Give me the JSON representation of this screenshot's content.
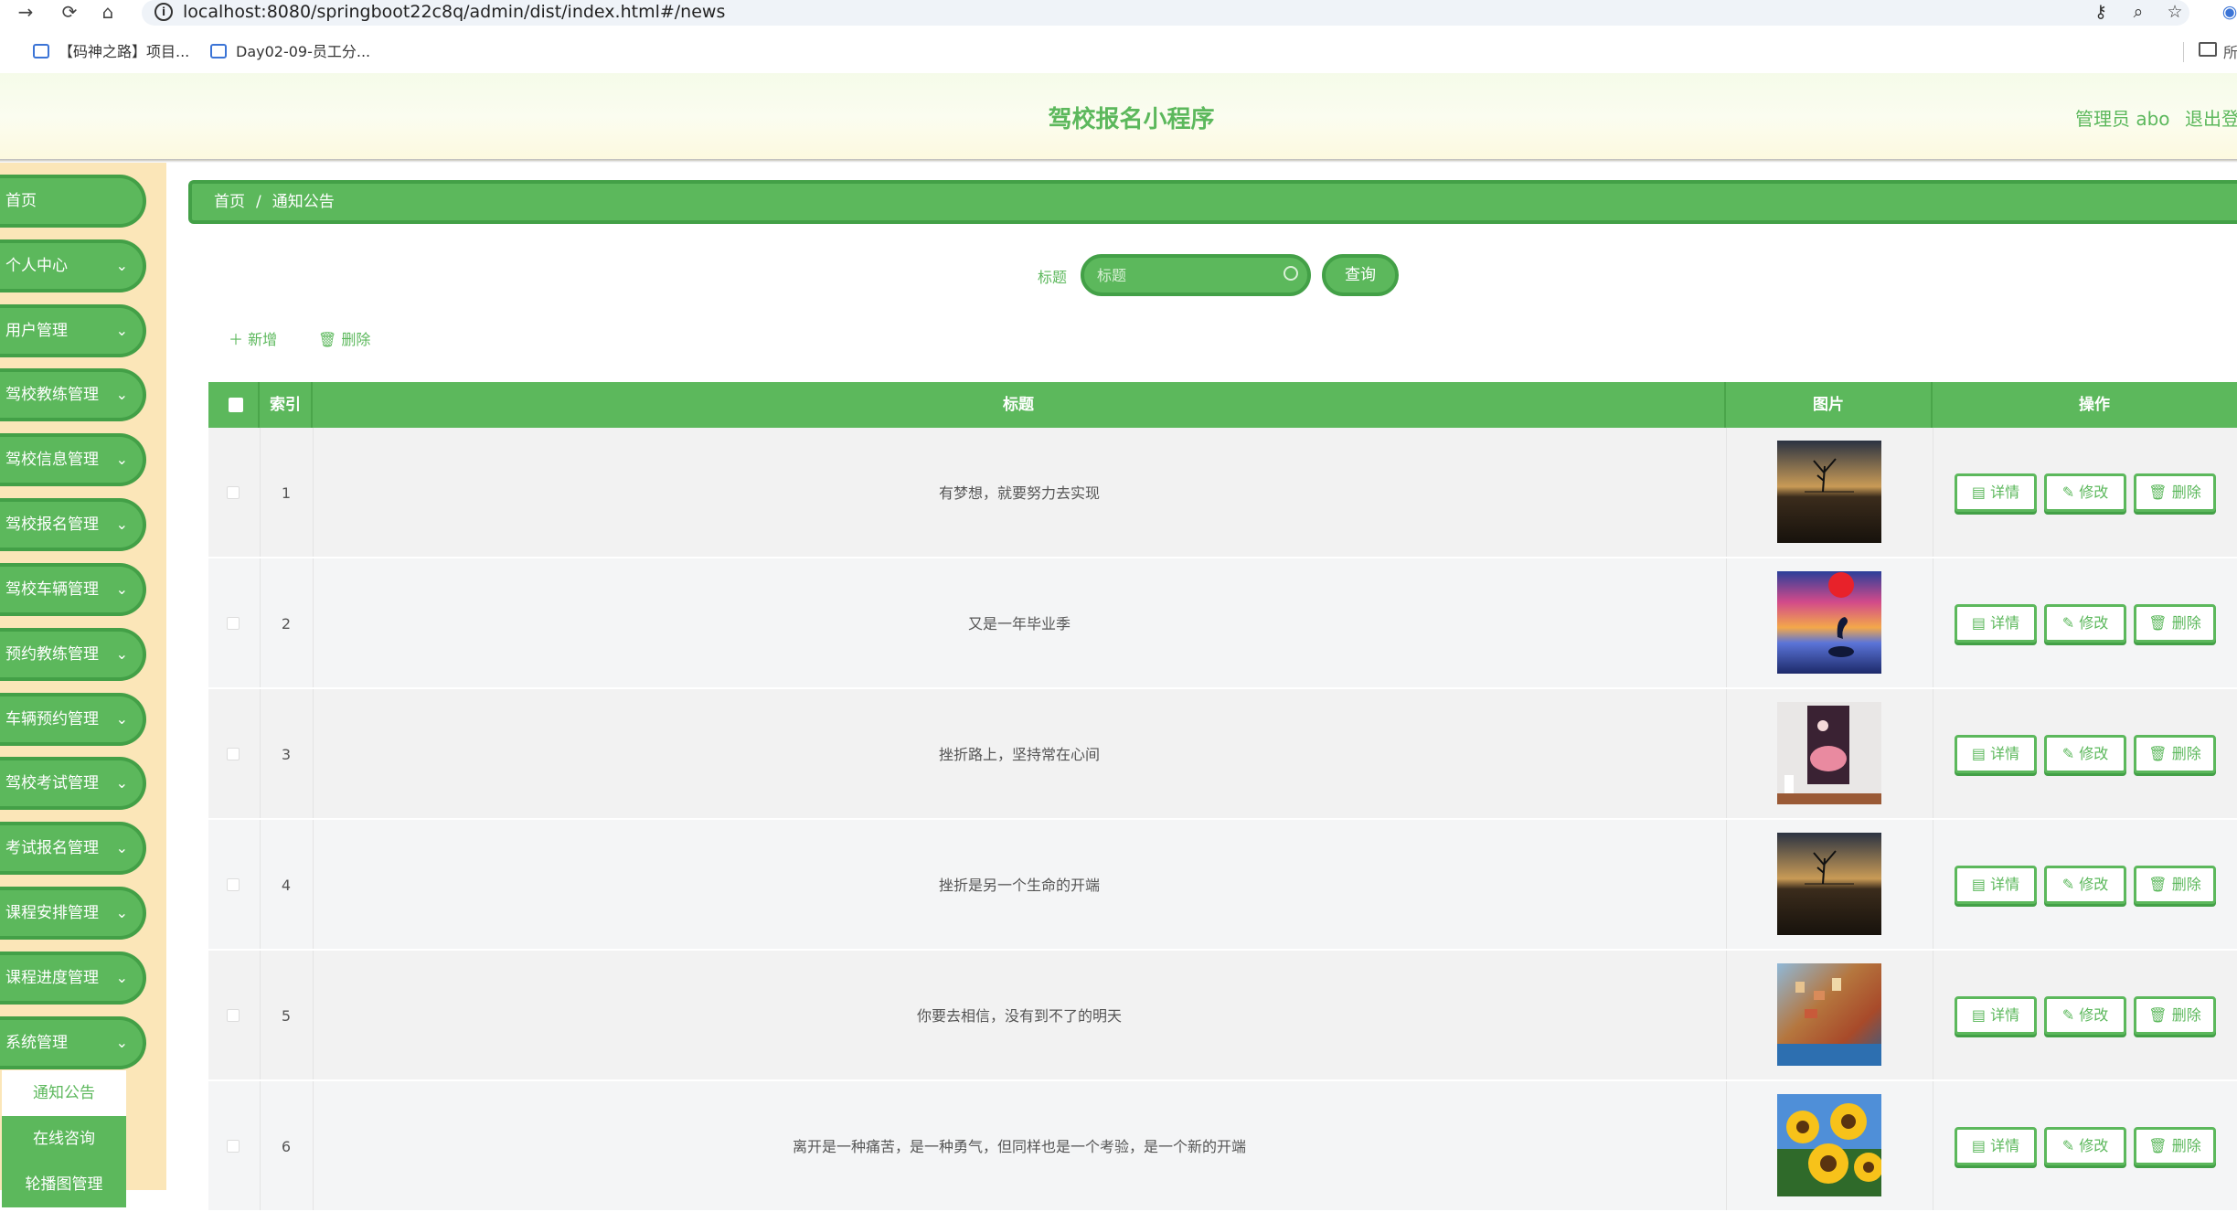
{
  "browser": {
    "url": "localhost:8080/springboot22c8q/admin/dist/index.html#/news",
    "bookmarks": [
      "【码神之路】项目...",
      "Day02-09-员工分..."
    ],
    "more_label": "所"
  },
  "header": {
    "title": "驾校报名小程序",
    "admin": "管理员 abo",
    "logout": "退出登"
  },
  "sidebar": {
    "items": [
      {
        "label": "首页",
        "has_arrow": false
      },
      {
        "label": "个人中心",
        "has_arrow": true
      },
      {
        "label": "用户管理",
        "has_arrow": true
      },
      {
        "label": "驾校教练管理",
        "has_arrow": true
      },
      {
        "label": "驾校信息管理",
        "has_arrow": true
      },
      {
        "label": "驾校报名管理",
        "has_arrow": true
      },
      {
        "label": "驾校车辆管理",
        "has_arrow": true
      },
      {
        "label": "预约教练管理",
        "has_arrow": true
      },
      {
        "label": "车辆预约管理",
        "has_arrow": true
      },
      {
        "label": "驾校考试管理",
        "has_arrow": true
      },
      {
        "label": "考试报名管理",
        "has_arrow": true
      },
      {
        "label": "课程安排管理",
        "has_arrow": true
      },
      {
        "label": "课程进度管理",
        "has_arrow": true
      },
      {
        "label": "系统管理",
        "has_arrow": true,
        "expanded": true
      }
    ],
    "submenu": [
      "通知公告",
      "在线咨询",
      "轮播图管理"
    ]
  },
  "breadcrumb": {
    "home": "首页",
    "separator": "/",
    "current": "通知公告"
  },
  "search": {
    "label": "标题",
    "placeholder": "标题",
    "button": "查询"
  },
  "actions": {
    "add": "新增",
    "delete": "删除"
  },
  "table": {
    "headers": {
      "index": "索引",
      "title": "标题",
      "image": "图片",
      "ops": "操作"
    },
    "ops": {
      "detail": "详情",
      "edit": "修改",
      "delete": "删除"
    },
    "rows": [
      {
        "index": "1",
        "title": "有梦想，就要努力去实现",
        "image": "lake-tree-sunset"
      },
      {
        "index": "2",
        "title": "又是一年毕业季",
        "image": "dolphin-sunset"
      },
      {
        "index": "3",
        "title": "挫折路上，坚持常在心间",
        "image": "framed-poster"
      },
      {
        "index": "4",
        "title": "挫折是另一个生命的开端",
        "image": "lake-tree-sunset"
      },
      {
        "index": "5",
        "title": "你要去相信，没有到不了的明天",
        "image": "cliff-village"
      },
      {
        "index": "6",
        "title": "离开是一种痛苦，是一种勇气，但同样也是一个考验，是一个新的开端",
        "image": "sunflowers"
      }
    ]
  }
}
